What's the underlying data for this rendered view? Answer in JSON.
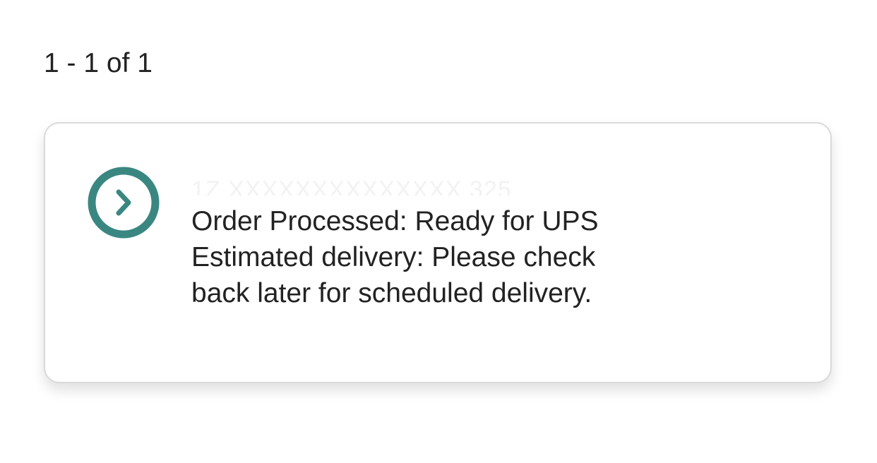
{
  "pagination": {
    "count_text": "1 - 1 of 1"
  },
  "shipment": {
    "tracking_number": "1Z XXXXXXXXXXXXXX 325",
    "status_line": "Order Processed: Ready for UPS",
    "estimate_line_1": "Estimated delivery: Please check",
    "estimate_line_2": "back later for scheduled delivery.",
    "expand_icon": "chevron-right-circle-icon",
    "accent_color": "#3a8782"
  }
}
